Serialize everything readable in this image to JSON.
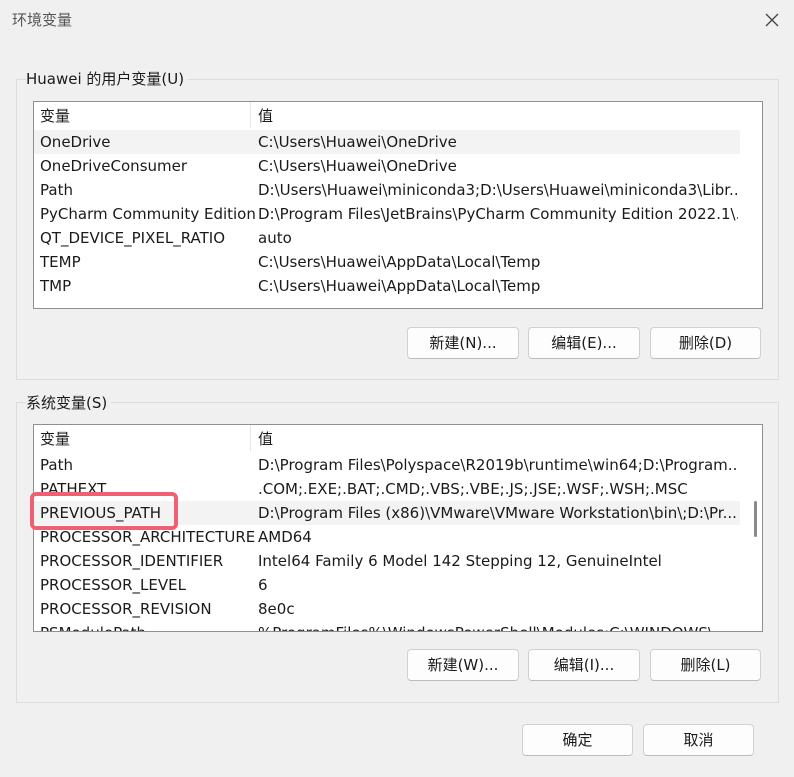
{
  "window": {
    "title": "环境变量"
  },
  "user_section": {
    "label": "Huawei 的用户变量(U)",
    "columns": [
      "变量",
      "值"
    ],
    "rows": [
      {
        "name": "OneDrive",
        "value": "C:\\Users\\Huawei\\OneDrive"
      },
      {
        "name": "OneDriveConsumer",
        "value": "C:\\Users\\Huawei\\OneDrive"
      },
      {
        "name": "Path",
        "value": "D:\\Users\\Huawei\\miniconda3;D:\\Users\\Huawei\\miniconda3\\Libr..."
      },
      {
        "name": "PyCharm Community Edition",
        "value": "D:\\Program Files\\JetBrains\\PyCharm Community Edition 2022.1\\..."
      },
      {
        "name": "QT_DEVICE_PIXEL_RATIO",
        "value": "auto"
      },
      {
        "name": "TEMP",
        "value": "C:\\Users\\Huawei\\AppData\\Local\\Temp"
      },
      {
        "name": "TMP",
        "value": "C:\\Users\\Huawei\\AppData\\Local\\Temp"
      }
    ],
    "buttons": {
      "new": "新建(N)...",
      "edit": "编辑(E)...",
      "delete": "删除(D)"
    }
  },
  "system_section": {
    "label": "系统变量(S)",
    "columns": [
      "变量",
      "值"
    ],
    "rows": [
      {
        "name": "Path",
        "value": "D:\\Program Files\\Polyspace\\R2019b\\runtime\\win64;D:\\Program..."
      },
      {
        "name": "PATHEXT",
        "value": ".COM;.EXE;.BAT;.CMD;.VBS;.VBE;.JS;.JSE;.WSF;.WSH;.MSC"
      },
      {
        "name": "PREVIOUS_PATH",
        "value": "D:\\Program Files (x86)\\VMware\\VMware Workstation\\bin\\;D:\\Pr..."
      },
      {
        "name": "PROCESSOR_ARCHITECTURE",
        "value": "AMD64"
      },
      {
        "name": "PROCESSOR_IDENTIFIER",
        "value": "Intel64 Family 6 Model 142 Stepping 12, GenuineIntel"
      },
      {
        "name": "PROCESSOR_LEVEL",
        "value": "6"
      },
      {
        "name": "PROCESSOR_REVISION",
        "value": "8e0c"
      },
      {
        "name": "PSModulePath",
        "value": "%ProgramFiles%\\WindowsPowerShell\\Modules;C:\\WINDOWS\\..."
      }
    ],
    "buttons": {
      "new": "新建(W)...",
      "edit": "编辑(I)...",
      "delete": "删除(L)"
    }
  },
  "footer": {
    "ok": "确定",
    "cancel": "取消"
  },
  "highlight_color": "#ef6072"
}
